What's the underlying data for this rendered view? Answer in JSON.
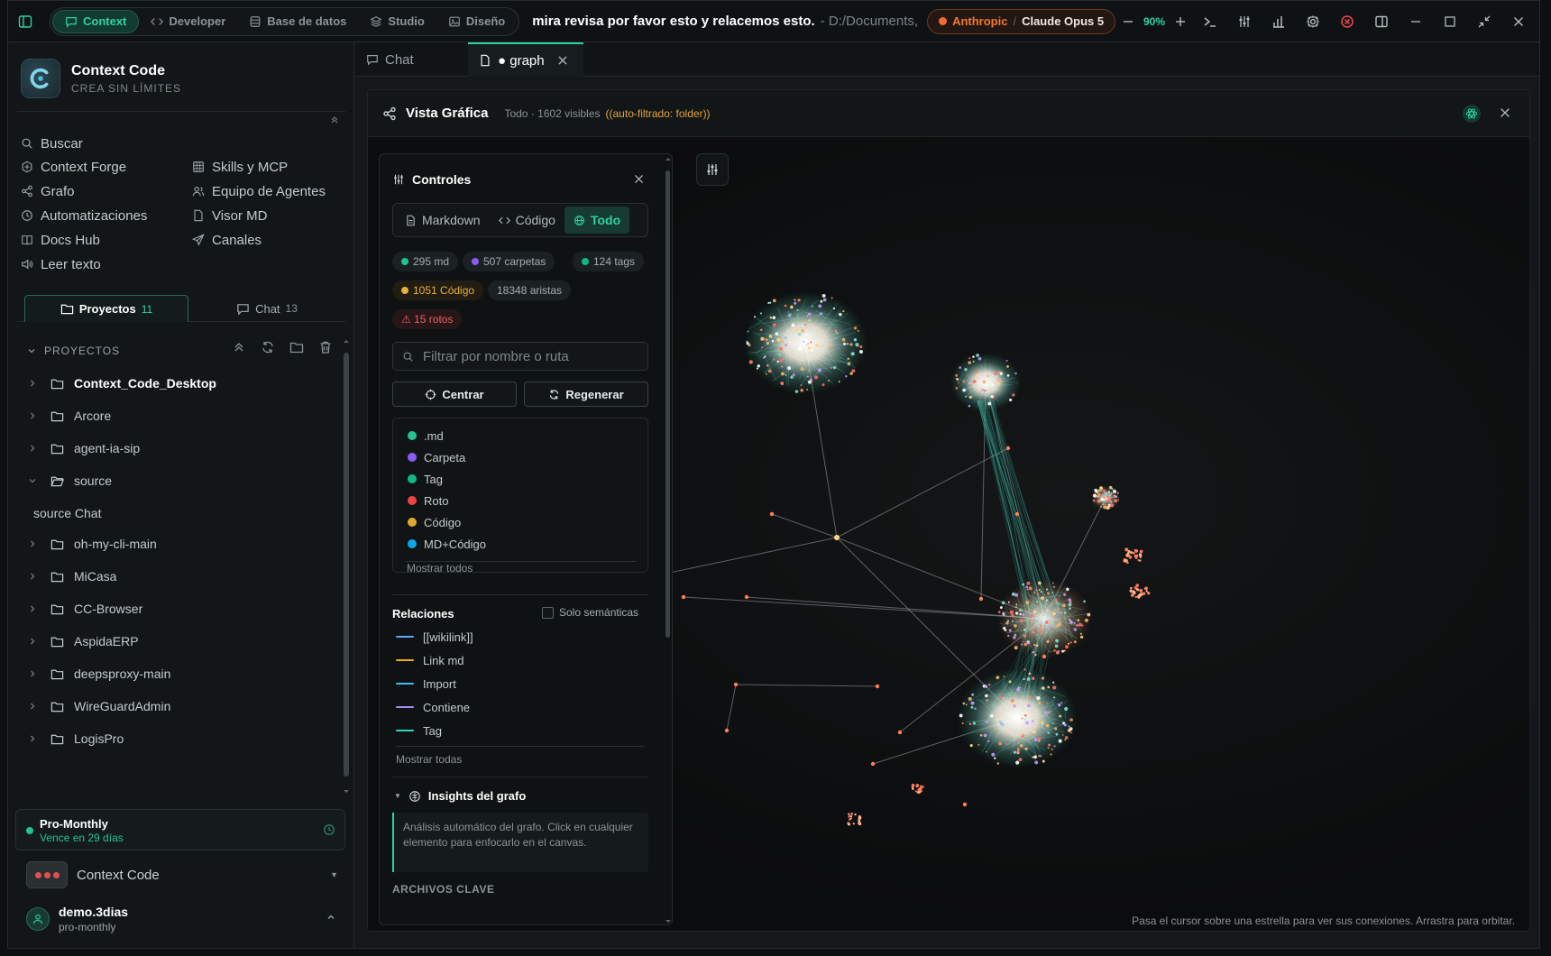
{
  "titlebar": {
    "modes": [
      {
        "label": "Context",
        "icon": "chat-bubble-icon",
        "active": true
      },
      {
        "label": "Developer",
        "icon": "code-brackets-icon",
        "active": false
      },
      {
        "label": "Base de datos",
        "icon": "database-icon",
        "active": false
      },
      {
        "label": "Studio",
        "icon": "layers-icon",
        "active": false
      },
      {
        "label": "Diseño",
        "icon": "image-icon",
        "active": false
      }
    ],
    "conversation_title": "mira revisa por favor esto y relacemos esto.",
    "path": "- D:/Documents,",
    "provider": "Anthropic",
    "separator": "/",
    "model": "Claude Opus 5",
    "zoom": "90%"
  },
  "sidebar": {
    "brand_name": "Context Code",
    "brand_tagline": "CREA SIN LÍMITES",
    "nav_left": [
      {
        "label": "Buscar",
        "icon": "search-icon"
      },
      {
        "label": "Context Forge",
        "icon": "forge-icon"
      },
      {
        "label": "Grafo",
        "icon": "share-graph-icon"
      },
      {
        "label": "Automatizaciones",
        "icon": "clock-icon"
      },
      {
        "label": "Docs Hub",
        "icon": "book-icon"
      },
      {
        "label": "Leer texto",
        "icon": "speaker-icon"
      }
    ],
    "nav_right": [
      {
        "label": "Skills y MCP",
        "icon": "grid-icon"
      },
      {
        "label": "Equipo de Agentes",
        "icon": "users-icon"
      },
      {
        "label": "Visor MD",
        "icon": "file-icon"
      },
      {
        "label": "Canales",
        "icon": "send-icon"
      }
    ],
    "tabs": [
      {
        "label": "Proyectos",
        "count": "11"
      },
      {
        "label": "Chat",
        "count": "13"
      }
    ],
    "projects_header": "PROYECTOS",
    "projects": [
      {
        "name": "Context_Code_Desktop",
        "kind": "folder-collapsed",
        "bold": true
      },
      {
        "name": "Arcore",
        "kind": "folder-collapsed"
      },
      {
        "name": "agent-ia-sip",
        "kind": "folder-collapsed"
      },
      {
        "name": "source",
        "kind": "folder-open"
      },
      {
        "name": "source Chat",
        "kind": "child"
      },
      {
        "name": "oh-my-cli-main",
        "kind": "folder-collapsed"
      },
      {
        "name": "MiCasa",
        "kind": "folder-collapsed"
      },
      {
        "name": "CC-Browser",
        "kind": "folder-collapsed"
      },
      {
        "name": "AspidaERP",
        "kind": "folder-collapsed"
      },
      {
        "name": "deepsproxy-main",
        "kind": "folder-collapsed"
      },
      {
        "name": "WireGuardAdmin",
        "kind": "folder-collapsed"
      },
      {
        "name": "LogisPro",
        "kind": "folder-collapsed"
      }
    ],
    "plan": {
      "name": "Pro-Monthly",
      "expires": "Vence en 29 días"
    },
    "workspace": "Context Code",
    "user": {
      "name": "demo.3dias",
      "plan": "pro-monthly"
    }
  },
  "editor_tabs": [
    {
      "label": "Chat",
      "active": false
    },
    {
      "label": "● graph",
      "active": true
    }
  ],
  "graph": {
    "title": "Vista Gráfica",
    "meta": "Todo · 1602 visibles",
    "auto_filter": "((auto-filtrado: folder))",
    "hint": "Pasa el cursor sobre una estrella para ver sus conexiones. Arrastra para orbitar."
  },
  "controls": {
    "title": "Controles",
    "modes": [
      {
        "label": "Markdown",
        "icon": "file-icon",
        "active": false
      },
      {
        "label": "Código",
        "icon": "code-brackets-icon",
        "active": false
      },
      {
        "label": "Todo",
        "icon": "globe-icon",
        "active": true
      }
    ],
    "chips": [
      {
        "label": "295 md",
        "color": "#22c38e"
      },
      {
        "label": "507 carpetas",
        "color": "#8b5cf6"
      },
      {
        "label": "124 tags",
        "color": "#10b981"
      },
      {
        "label": "1051 Código",
        "color": "#e9b13b"
      },
      {
        "label": "18348 aristas",
        "color": ""
      },
      {
        "label": "⚠ 15 rotos",
        "color": "#f06060"
      }
    ],
    "filter_placeholder": "Filtrar por nombre o ruta",
    "center_label": "Centrar",
    "regen_label": "Regenerar",
    "legend": [
      {
        "label": ".md",
        "color": "#22c38e"
      },
      {
        "label": "Carpeta",
        "color": "#8b5cf6"
      },
      {
        "label": "Tag",
        "color": "#10b981"
      },
      {
        "label": "Roto",
        "color": "#ef4444"
      },
      {
        "label": "Código",
        "color": "#e0a82e"
      },
      {
        "label": "MD+Código",
        "color": "#0ea5e9"
      }
    ],
    "legend_more": "Mostrar todos",
    "relations_title": "Relaciones",
    "semantic_only": "Solo semánticas",
    "relations": [
      {
        "label": "[[wikilink]]",
        "color": "#60a5fa"
      },
      {
        "label": "Link md",
        "color": "#f5a623"
      },
      {
        "label": "Import",
        "color": "#38bdf8"
      },
      {
        "label": "Contiene",
        "color": "#a78bfa"
      },
      {
        "label": "Tag",
        "color": "#2dd4bf"
      }
    ],
    "relations_more": "Mostrar todas",
    "insights_title": "Insights del grafo",
    "insights_text": "Análisis automático del grafo. Click en cualquier elemento para enfocarlo en el canvas.",
    "key_files": "ARCHIVOS CLAVE"
  }
}
